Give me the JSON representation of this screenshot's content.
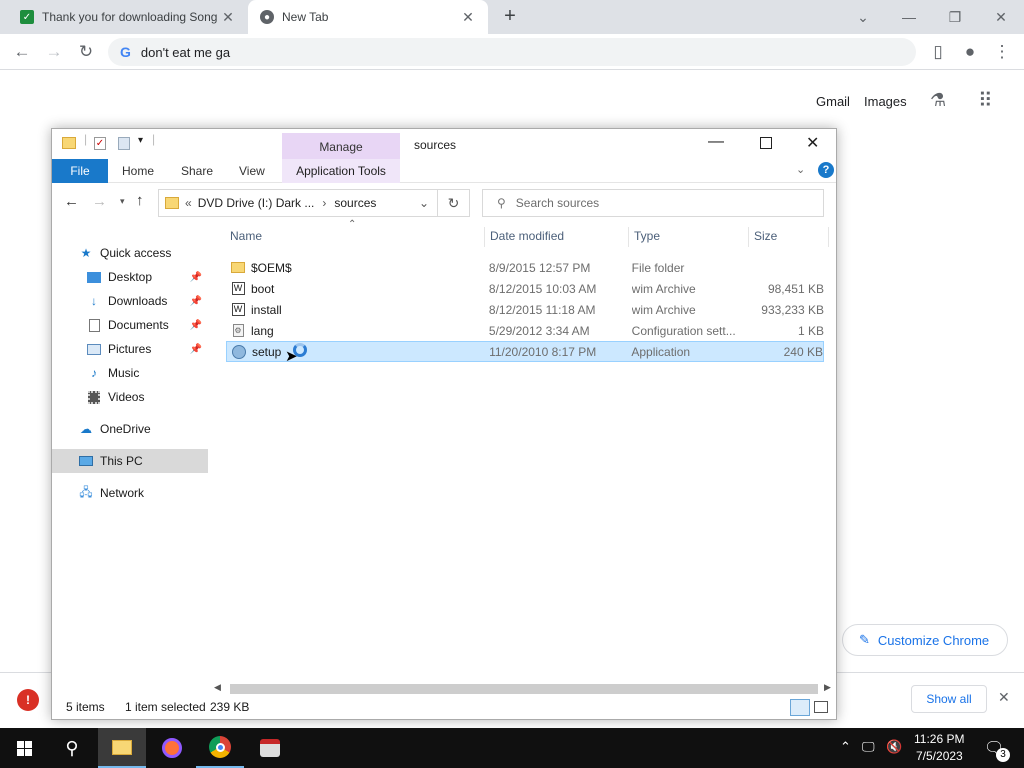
{
  "browser": {
    "tabs": [
      {
        "title": "Thank you for downloading Song"
      },
      {
        "title": "New Tab"
      }
    ],
    "address": "don't eat me ga",
    "google_links": {
      "gmail": "Gmail",
      "images": "Images"
    },
    "customize_label": "Customize Chrome",
    "download_bar": {
      "show_all": "Show all"
    }
  },
  "explorer": {
    "title": "sources",
    "manage_tab": "Manage",
    "ribbon_tabs": {
      "file": "File",
      "home": "Home",
      "share": "Share",
      "view": "View",
      "app_tools": "Application Tools"
    },
    "breadcrumb": {
      "prefix": "«",
      "drive": "DVD Drive (I:) Dark ...",
      "sep": "›",
      "folder": "sources"
    },
    "search_placeholder": "Search sources",
    "nav": {
      "quick_access": "Quick access",
      "desktop": "Desktop",
      "downloads": "Downloads",
      "documents": "Documents",
      "pictures": "Pictures",
      "music": "Music",
      "videos": "Videos",
      "onedrive": "OneDrive",
      "thispc": "This PC",
      "network": "Network"
    },
    "columns": {
      "name": "Name",
      "date": "Date modified",
      "type": "Type",
      "size": "Size"
    },
    "files": [
      {
        "name": "$OEM$",
        "date": "8/9/2015 12:57 PM",
        "type": "File folder",
        "size": ""
      },
      {
        "name": "boot",
        "date": "8/12/2015 10:03 AM",
        "type": "wim Archive",
        "size": "98,451 KB"
      },
      {
        "name": "install",
        "date": "8/12/2015 11:18 AM",
        "type": "wim Archive",
        "size": "933,233 KB"
      },
      {
        "name": "lang",
        "date": "5/29/2012 3:34 AM",
        "type": "Configuration sett...",
        "size": "1 KB"
      },
      {
        "name": "setup",
        "date": "11/20/2010 8:17 PM",
        "type": "Application",
        "size": "240 KB"
      }
    ],
    "status": {
      "items": "5 items",
      "selected": "1 item selected",
      "selected_size": "239 KB"
    }
  },
  "taskbar": {
    "time": "11:26 PM",
    "date": "7/5/2023",
    "notification_count": "3"
  },
  "colors": {
    "accent": "#1979ca",
    "selection": "#cce8ff",
    "manage": "#e8d6f5"
  }
}
